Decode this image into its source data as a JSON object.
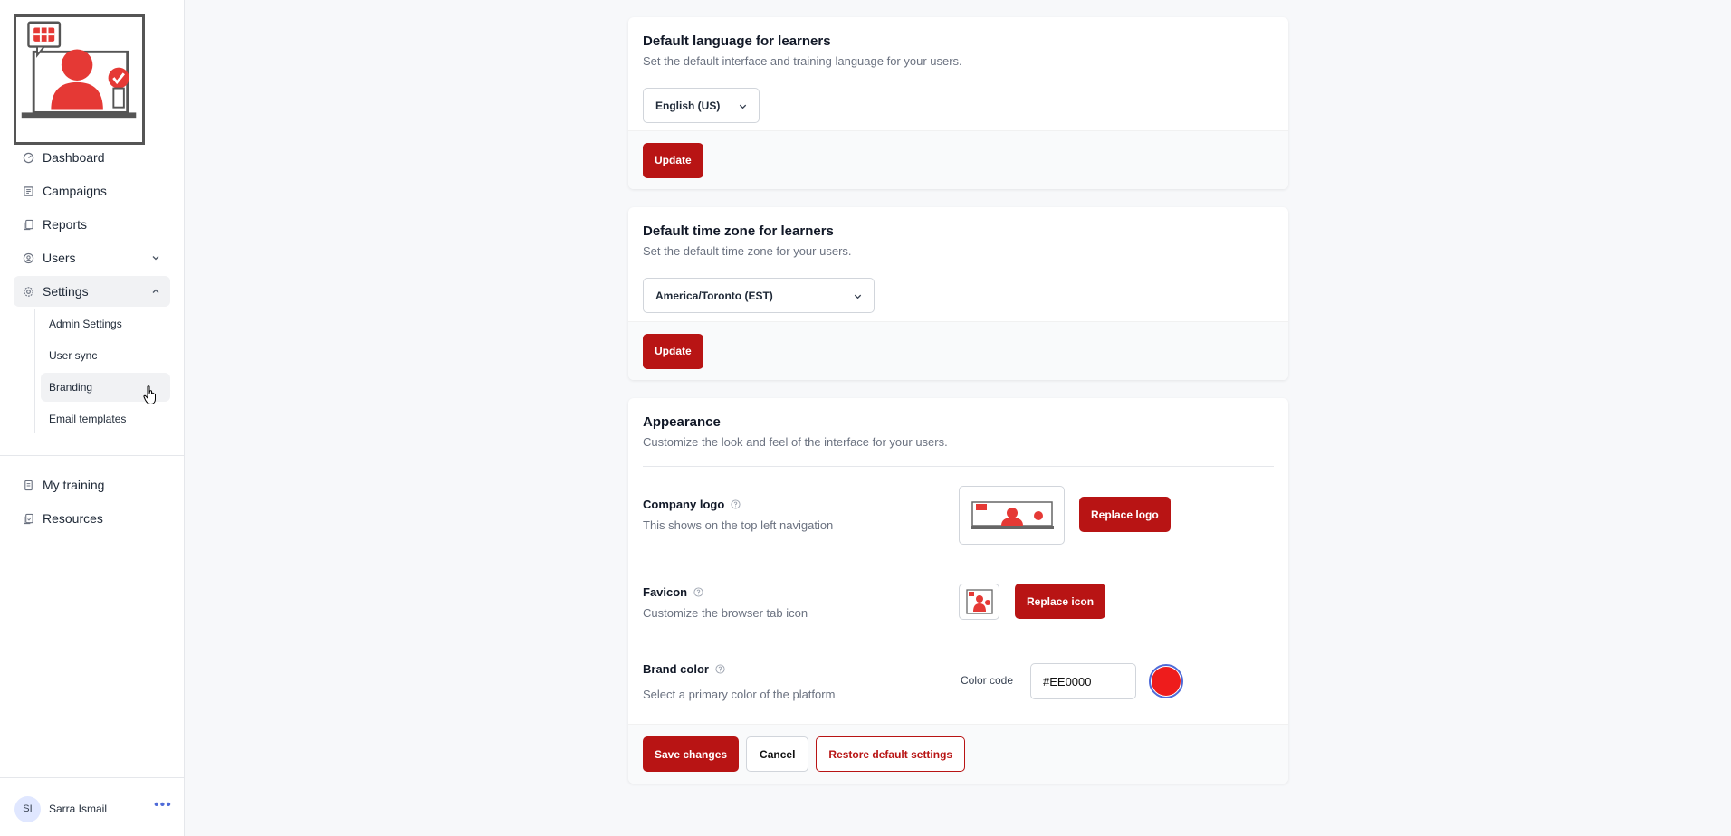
{
  "sidebar": {
    "nav_items": [
      {
        "label": "Dashboard",
        "icon": "dashboard-icon"
      },
      {
        "label": "Campaigns",
        "icon": "campaigns-icon"
      },
      {
        "label": "Reports",
        "icon": "reports-icon"
      },
      {
        "label": "Users",
        "icon": "users-icon"
      },
      {
        "label": "Settings",
        "icon": "gear-icon"
      }
    ],
    "settings_sub_items": [
      {
        "label": "Admin Settings"
      },
      {
        "label": "User sync"
      },
      {
        "label": "Branding"
      },
      {
        "label": "Email templates"
      }
    ],
    "nav_items_2": [
      {
        "label": "My training",
        "icon": "training-icon"
      },
      {
        "label": "Resources",
        "icon": "resources-icon"
      }
    ],
    "user": {
      "initials": "SI",
      "name": "Sarra Ismail"
    }
  },
  "language_card": {
    "title": "Default language for learners",
    "description": "Set the default interface and training language for your users.",
    "selected": "English (US)",
    "update_label": "Update"
  },
  "timezone_card": {
    "title": "Default time zone for learners",
    "description": "Set the default time zone for your users.",
    "selected": "America/Toronto (EST)",
    "update_label": "Update"
  },
  "appearance_card": {
    "title": "Appearance",
    "description": "Customize the look and feel of the interface for your users.",
    "company_logo": {
      "label": "Company logo",
      "description": "This shows on the top left navigation",
      "button": "Replace logo"
    },
    "favicon": {
      "label": "Favicon",
      "description": "Customize the browser tab icon",
      "button": "Replace icon"
    },
    "brand_color": {
      "label": "Brand color",
      "description": "Select a primary color of the platform",
      "color_code_label": "Color code",
      "value": "#EE0000"
    },
    "footer": {
      "save_label": "Save changes",
      "cancel_label": "Cancel",
      "restore_label": "Restore default settings"
    }
  },
  "colors": {
    "primary_button": "#b81414",
    "brand_swatch": "#ee1c1c",
    "swatch_ring": "#4f6bd8"
  }
}
